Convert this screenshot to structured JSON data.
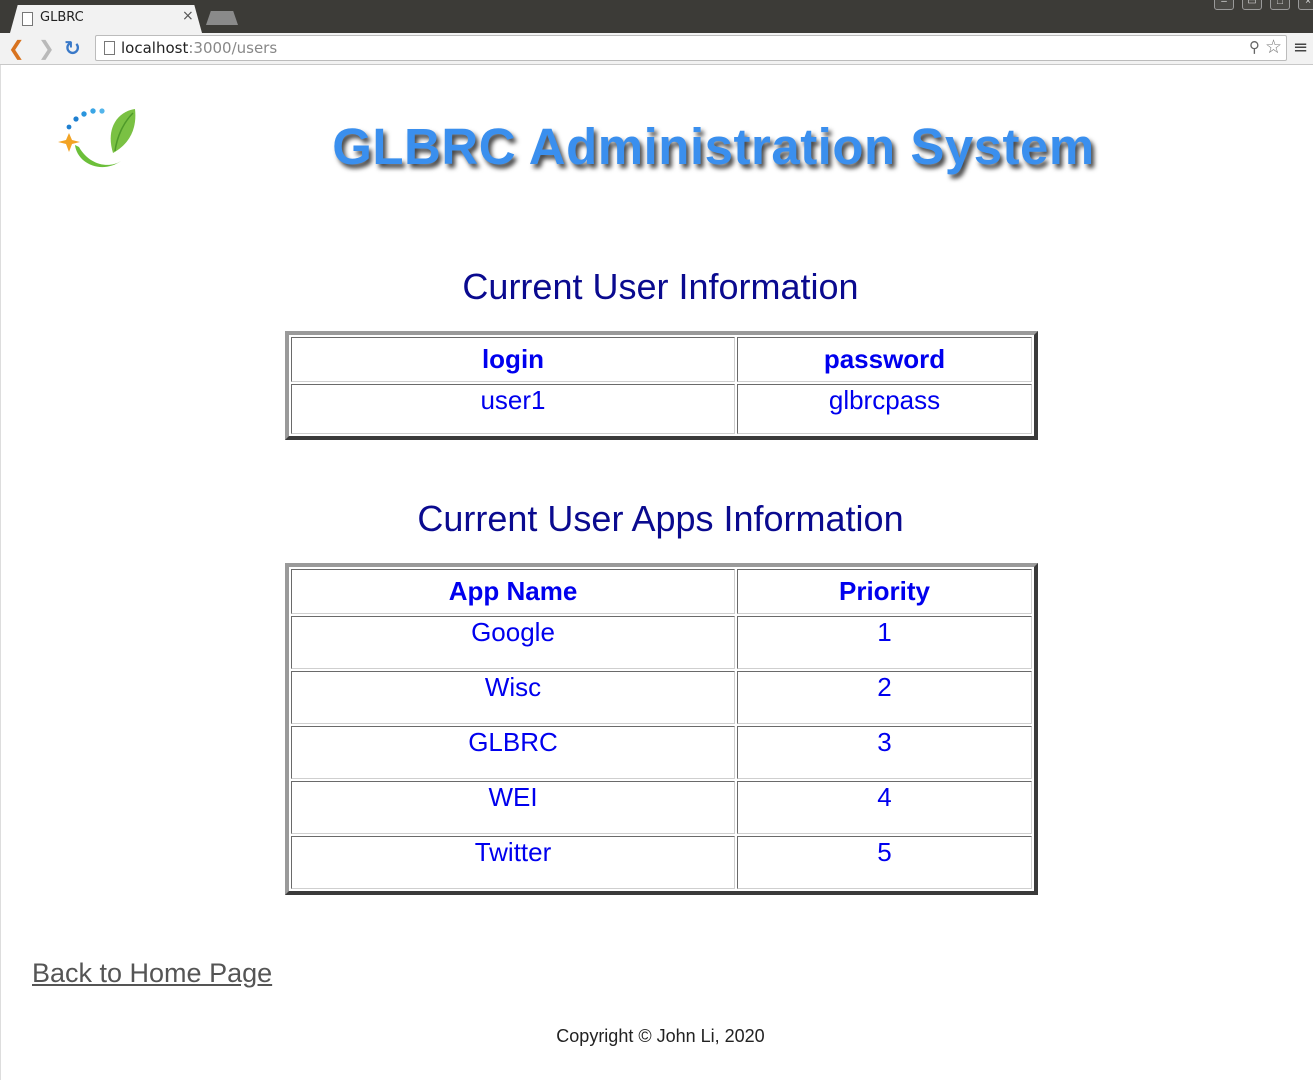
{
  "browser": {
    "tab_title": "GLBRC",
    "tab_close": "×",
    "url_host": "localhost",
    "url_path": ":3000/users",
    "icons": [
      "page-icon",
      "back-icon",
      "forward-icon",
      "reload-icon",
      "zoom-icon",
      "star-icon",
      "menu-icon"
    ]
  },
  "header": {
    "title": "GLBRC Administration System"
  },
  "user_section": {
    "heading": "Current User Information",
    "columns": [
      "login",
      "password"
    ],
    "rows": [
      [
        "user1",
        "glbrcpass"
      ]
    ]
  },
  "apps_section": {
    "heading": "Current User Apps Information",
    "columns": [
      "App Name",
      "Priority"
    ],
    "rows": [
      [
        "Google",
        "1"
      ],
      [
        "Wisc",
        "2"
      ],
      [
        "GLBRC",
        "3"
      ],
      [
        "WEI",
        "4"
      ],
      [
        "Twitter",
        "5"
      ]
    ]
  },
  "footer": {
    "back_link": "Back to Home Page",
    "copyright": "Copyright © John Li, 2020"
  },
  "colors": {
    "title": "#3a8fee",
    "heading": "#0a0a8f",
    "table_text": "#0000ee",
    "link": "#555555"
  }
}
